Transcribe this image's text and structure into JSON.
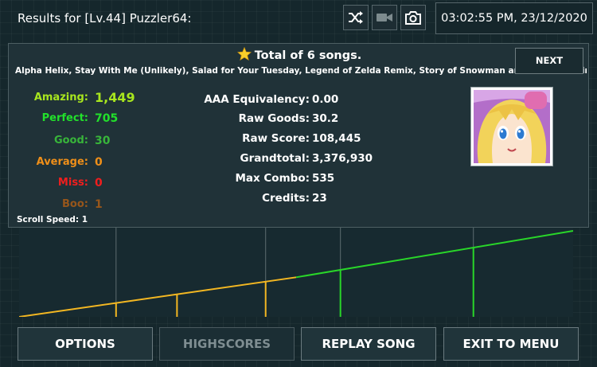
{
  "header": {
    "title": "Results for [Lv.44] Puzzler64:",
    "datetime": "03:02:55 PM, 23/12/2020",
    "tools": [
      "shuffle-icon",
      "video-camera-icon",
      "camera-icon"
    ]
  },
  "summary": {
    "total": "Total of 6 songs.",
    "next_label": "NEXT",
    "songs": "Alpha Helix, Stay With Me (Unlikely), Salad for Your Tuesday, Legend of Zelda Remix, Story of Snowman and Sunshine Girl, The"
  },
  "judgements": [
    {
      "label": "Amazing:",
      "value": "1,449",
      "color": "#a8e61e"
    },
    {
      "label": "Perfect:",
      "value": "705",
      "color": "#22e02b"
    },
    {
      "label": "Good:",
      "value": "30",
      "color": "#38b53a"
    },
    {
      "label": "Average:",
      "value": "0",
      "color": "#ef8f19"
    },
    {
      "label": "Miss:",
      "value": "0",
      "color": "#f01e1e"
    },
    {
      "label": "Boo:",
      "value": "1",
      "color": "#97561b"
    }
  ],
  "stats": [
    {
      "label": "AAA Equivalency:",
      "value": "0.00"
    },
    {
      "label": "Raw Goods:",
      "value": "30.2"
    },
    {
      "label": "Raw Score:",
      "value": "108,445"
    },
    {
      "label": "Grandtotal:",
      "value": "3,376,930"
    },
    {
      "label": "Max Combo:",
      "value": "535"
    },
    {
      "label": "Credits:",
      "value": "23"
    }
  ],
  "scroll_speed": "Scroll Speed: 1",
  "graph": {
    "colors": {
      "gold": "#f3b722",
      "green": "#29d629",
      "grid": "#5d6d70"
    },
    "section_dividers": [
      0.175,
      0.445,
      0.58,
      0.82
    ],
    "segments": [
      {
        "from": [
          0.0,
          0.0
        ],
        "to": [
          0.5,
          0.46
        ],
        "color": "gold"
      },
      {
        "from": [
          0.5,
          0.46
        ],
        "to": [
          1.0,
          1.0
        ],
        "color": "green"
      }
    ],
    "markers": [
      {
        "x": 0.175,
        "color": "gold"
      },
      {
        "x": 0.285,
        "color": "gold"
      },
      {
        "x": 0.445,
        "color": "gold"
      },
      {
        "x": 0.58,
        "color": "green"
      },
      {
        "x": 0.82,
        "color": "green"
      }
    ]
  },
  "buttons": [
    {
      "label": "OPTIONS",
      "enabled": true
    },
    {
      "label": "HIGHSCORES",
      "enabled": false
    },
    {
      "label": "REPLAY SONG",
      "enabled": true
    },
    {
      "label": "EXIT TO MENU",
      "enabled": true
    }
  ]
}
